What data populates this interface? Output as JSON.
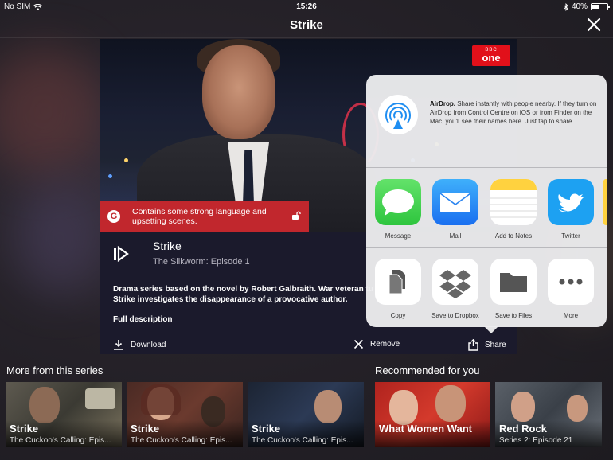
{
  "status_bar": {
    "carrier": "No SIM",
    "time": "15:26",
    "battery": "40%"
  },
  "nav": {
    "title": "Strike"
  },
  "programme": {
    "channel_logo_line1": "BBC",
    "channel_logo_line2": "one",
    "guidance_badge": "G",
    "guidance_text": "Contains some strong language and upsetting scenes.",
    "title": "Strike",
    "episode": "The Silkworm: Episode 1",
    "description_line1": "Drama series based on the novel by Robert Galbraith. War veteran tu",
    "description_line2": "Strike investigates the disappearance of a provocative author.",
    "full_description": "Full description",
    "actions": {
      "download": "Download",
      "remove": "Remove",
      "share": "Share"
    }
  },
  "share_sheet": {
    "airdrop_title": "AirDrop.",
    "airdrop_text": " Share instantly with people nearby. If they turn on AirDrop from Control Centre on iOS or from Finder on the Mac, you'll see their names here. Just tap to share.",
    "apps": [
      "Message",
      "Mail",
      "Add to Notes",
      "Twitter"
    ],
    "actions": [
      "Copy",
      "Save to Dropbox",
      "Save to Files",
      "More"
    ]
  },
  "more_from_series": {
    "heading": "More from this series",
    "items": [
      {
        "title": "Strike",
        "subtitle": "The Cuckoo's Calling: Epis..."
      },
      {
        "title": "Strike",
        "subtitle": "The Cuckoo's Calling: Epis..."
      },
      {
        "title": "Strike",
        "subtitle": "The Cuckoo's Calling: Epis..."
      }
    ]
  },
  "recommended": {
    "heading": "Recommended for you",
    "items": [
      {
        "title": "What Women Want",
        "subtitle": ""
      },
      {
        "title": "Red Rock",
        "subtitle": "Series 2: Episode 21"
      }
    ]
  },
  "colors": {
    "warning_red": "#c1272d",
    "bbc_red": "#e1101a",
    "twitter_blue": "#1da1f2",
    "airdrop_blue": "#1f8ef1"
  }
}
